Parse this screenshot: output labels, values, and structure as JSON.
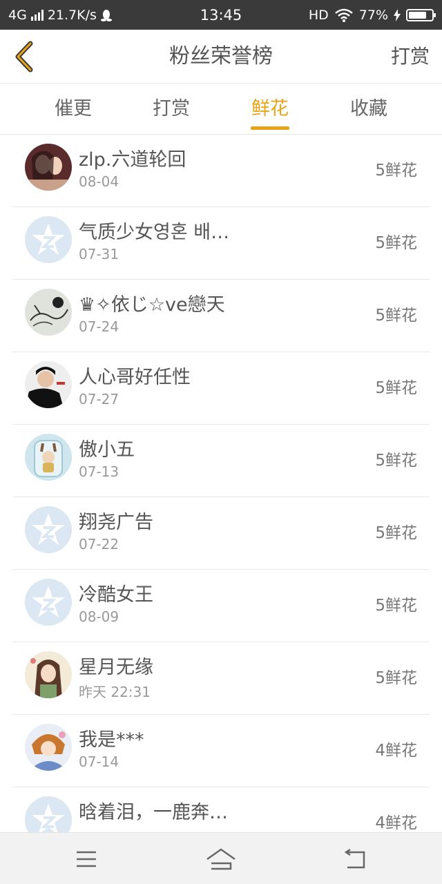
{
  "status_bar": {
    "network": "4G",
    "speed": "21.7K/s",
    "time": "13:45",
    "hd": "HD",
    "battery": "77%",
    "battery_level": 0.77
  },
  "header": {
    "title": "粉丝荣誉榜",
    "right_action": "打赏",
    "back_icon": "chevron-left-icon",
    "accent_color": "#e8a317"
  },
  "tabs": [
    {
      "label": "催更",
      "active": false
    },
    {
      "label": "打赏",
      "active": false
    },
    {
      "label": "鲜花",
      "active": true
    },
    {
      "label": "收藏",
      "active": false
    }
  ],
  "fans": [
    {
      "name": "zlp.六道轮回",
      "date": "08-04",
      "count": "5鲜花",
      "avatar": "photo-avatar"
    },
    {
      "name": "气质少女영혼 배…",
      "date": "07-31",
      "count": "5鲜花",
      "avatar": "default-avatar"
    },
    {
      "name": "♛✧依じ☆ve戀天",
      "date": "07-24",
      "count": "5鲜花",
      "avatar": "sketch-avatar"
    },
    {
      "name": "人心哥好任性",
      "date": "07-27",
      "count": "5鲜花",
      "avatar": "photo-avatar"
    },
    {
      "name": "傲小五",
      "date": "07-13",
      "count": "5鲜花",
      "avatar": "cartoon-avatar"
    },
    {
      "name": "翔尧广告",
      "date": "07-22",
      "count": "5鲜花",
      "avatar": "default-avatar"
    },
    {
      "name": "冷酷女王",
      "date": "08-09",
      "count": "5鲜花",
      "avatar": "default-avatar"
    },
    {
      "name": "星月无缘",
      "date": "昨天 22:31",
      "count": "5鲜花",
      "avatar": "anime-avatar"
    },
    {
      "name": "我是***",
      "date": "07-14",
      "count": "4鲜花",
      "avatar": "anime-avatar"
    },
    {
      "name": "晗着泪，一鹿奔…",
      "date": "",
      "count": "4鲜花",
      "avatar": "default-avatar"
    }
  ],
  "bottom_nav": {
    "menu_icon": "menu-icon",
    "home_icon": "home-icon",
    "back_icon": "back-arrow-icon"
  }
}
